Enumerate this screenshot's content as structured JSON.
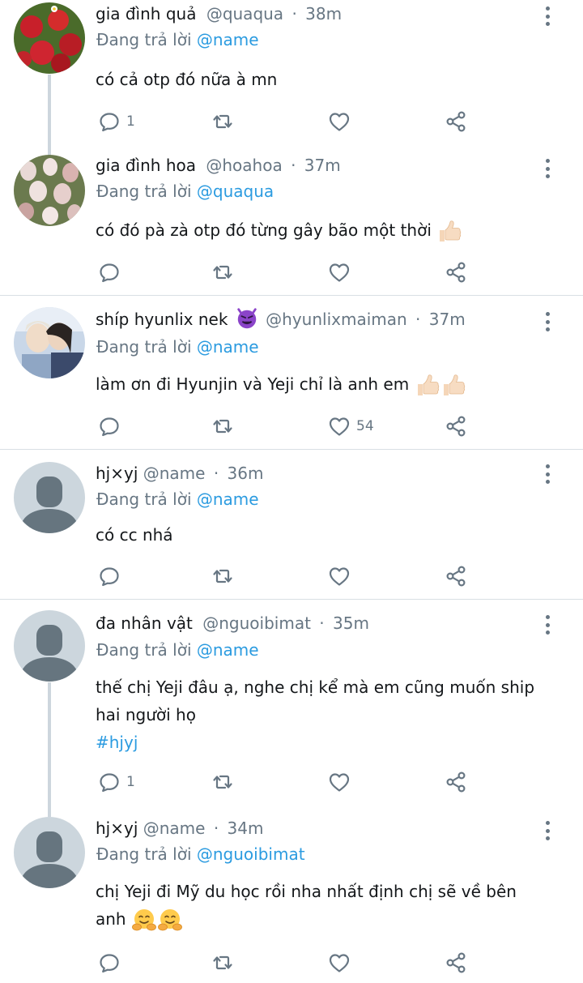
{
  "colors": {
    "accent": "#2b9be0",
    "muted": "#677683",
    "text": "#14171a",
    "divider": "#d9dfe4",
    "thread": "#cdd6dd"
  },
  "replying_label": "Đang trả lời",
  "tweets": [
    {
      "display_name": "gia đình quả",
      "handle": "@quaqua",
      "time": "38m",
      "reply_to": "@name",
      "text": "có cả otp đó nữa à mn",
      "reply_count": "1",
      "like_count": "",
      "avatar": "strawberry-avatar"
    },
    {
      "display_name": "gia đình hoa",
      "handle": "@hoahoa",
      "time": "37m",
      "reply_to": "@quaqua",
      "text": "có đó pà zà otp đó từng gây bão một thời",
      "reply_count": "",
      "like_count": "",
      "avatar": "flowers-avatar"
    },
    {
      "display_name": "shíp hyunlix nek",
      "handle": "@hyunlixmaiman",
      "time": "37m",
      "reply_to": "@name",
      "text": "làm ơn đi Hyunjin và Yeji chỉ là anh em",
      "reply_count": "",
      "like_count": "54",
      "avatar": "photo-avatar"
    },
    {
      "display_name": "hj×yj",
      "handle": "@name",
      "time": "36m",
      "reply_to": "@name",
      "text": "có cc nhá",
      "reply_count": "",
      "like_count": "",
      "avatar": "default-avatar"
    },
    {
      "display_name": "đa nhân vật",
      "handle": "@nguoibimat",
      "time": "35m",
      "reply_to": "@name",
      "text_line1": "thế chị Yeji đâu ạ, nghe chị kể mà em cũng muốn ship",
      "text_line2": "hai người họ",
      "hashtag": "#hjyj",
      "reply_count": "1",
      "like_count": "",
      "avatar": "default-avatar"
    },
    {
      "display_name": "hj×yj",
      "handle": "@name",
      "time": "34m",
      "reply_to": "@nguoibimat",
      "text_line1": "chị Yeji đi Mỹ du học rồi nha nhất định chị sẽ về bên",
      "text_line2": "anh",
      "reply_count": "",
      "like_count": "",
      "avatar": "default-avatar"
    }
  ],
  "separator": "·"
}
